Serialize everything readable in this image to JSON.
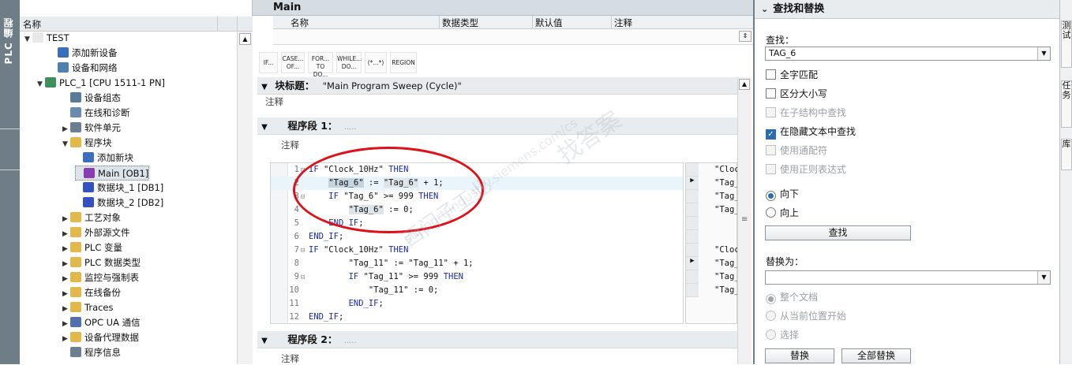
{
  "left_strip": {
    "label": "PLC 编程"
  },
  "tree": {
    "header": "名称",
    "items": [
      {
        "label": "TEST",
        "indent": 0,
        "expand": "▼",
        "icon": "project-icon",
        "color": "#e8e8e8"
      },
      {
        "label": "添加新设备",
        "indent": 2,
        "expand": "",
        "icon": "add-device-icon",
        "color": "#3a6fc0"
      },
      {
        "label": "设备和网络",
        "indent": 2,
        "expand": "",
        "icon": "network-icon",
        "color": "#4d7fb0"
      },
      {
        "label": "PLC_1 [CPU 1511-1 PN]",
        "indent": 1,
        "expand": "▼",
        "icon": "plc-icon",
        "color": "#3d8f5a"
      },
      {
        "label": "设备组态",
        "indent": 3,
        "expand": "",
        "icon": "device-config-icon",
        "color": "#5a7a9a"
      },
      {
        "label": "在线和诊断",
        "indent": 3,
        "expand": "",
        "icon": "diagnostics-icon",
        "color": "#6b8ab0"
      },
      {
        "label": "软件单元",
        "indent": 3,
        "expand": "▶",
        "icon": "software-unit-icon",
        "color": "#6b7f92"
      },
      {
        "label": "程序块",
        "indent": 3,
        "expand": "▼",
        "icon": "folder-icon",
        "color": "#e2b84a"
      },
      {
        "label": "添加新块",
        "indent": 4,
        "expand": "",
        "icon": "add-block-icon",
        "color": "#3a6fc0"
      },
      {
        "label": "Main [OB1]",
        "indent": 4,
        "expand": "",
        "icon": "ob-icon",
        "color": "#8a3db0"
      },
      {
        "label": "数据块_1 [DB1]",
        "indent": 4,
        "expand": "",
        "icon": "db-icon",
        "color": "#3550c0"
      },
      {
        "label": "数据块_2 [DB2]",
        "indent": 4,
        "expand": "",
        "icon": "db-icon",
        "color": "#3550c0"
      },
      {
        "label": "工艺对象",
        "indent": 3,
        "expand": "▶",
        "icon": "technology-icon",
        "color": "#e2b84a"
      },
      {
        "label": "外部源文件",
        "indent": 3,
        "expand": "▶",
        "icon": "source-icon",
        "color": "#e2b84a"
      },
      {
        "label": "PLC 变量",
        "indent": 3,
        "expand": "▶",
        "icon": "tags-icon",
        "color": "#e2b84a"
      },
      {
        "label": "PLC 数据类型",
        "indent": 3,
        "expand": "▶",
        "icon": "datatype-icon",
        "color": "#e2b84a"
      },
      {
        "label": "监控与强制表",
        "indent": 3,
        "expand": "▶",
        "icon": "watch-icon",
        "color": "#e2b84a"
      },
      {
        "label": "在线备份",
        "indent": 3,
        "expand": "▶",
        "icon": "backup-icon",
        "color": "#e2b84a"
      },
      {
        "label": "Traces",
        "indent": 3,
        "expand": "▶",
        "icon": "traces-icon",
        "color": "#e2b84a"
      },
      {
        "label": "OPC UA 通信",
        "indent": 3,
        "expand": "▶",
        "icon": "opcua-icon",
        "color": "#5070b0"
      },
      {
        "label": "设备代理数据",
        "indent": 3,
        "expand": "▶",
        "icon": "proxy-icon",
        "color": "#e2b84a"
      },
      {
        "label": "程序信息",
        "indent": 3,
        "expand": "",
        "icon": "info-icon",
        "color": "#6a7f90"
      }
    ]
  },
  "editor": {
    "tab_title": "Main",
    "interface_columns": [
      "名称",
      "数据类型",
      "默认值",
      "注释"
    ],
    "toolbar": [
      "IF...",
      "CASE... OF...",
      "FOR... TO DO...",
      "WHILE... DO...",
      "(*...*)",
      "REGION"
    ],
    "block_title_label": "块标题：",
    "block_title_value": "\"Main Program Sweep (Cycle)\"",
    "comment": "注释",
    "network1_label": "程序段 1：",
    "network1_dots": ".....",
    "network2_label": "程序段 2：",
    "network2_dots": ".....",
    "code_lines": [
      {
        "n": "1",
        "fold": "⊟",
        "parts": [
          [
            "kw",
            "IF "
          ],
          [
            "",
            "\"Clock_10Hz\" "
          ],
          [
            "kw",
            "THEN"
          ]
        ]
      },
      {
        "n": "2",
        "fold": "",
        "parts": [
          [
            "",
            "    "
          ],
          [
            "hl",
            "\"Tag_6\""
          ],
          [
            "",
            " := "
          ],
          [
            "hl2",
            "\"Tag_6\""
          ],
          [
            "",
            " + 1;"
          ]
        ]
      },
      {
        "n": "3",
        "fold": "⊟",
        "parts": [
          [
            "",
            "    "
          ],
          [
            "kw",
            "IF "
          ],
          [
            "",
            "\"Tag_6\" >= 999 "
          ],
          [
            "kw",
            "THEN"
          ]
        ]
      },
      {
        "n": "4",
        "fold": "",
        "parts": [
          [
            "",
            "        "
          ],
          [
            "hl2",
            "\"Tag_6\""
          ],
          [
            "",
            " := 0;"
          ]
        ]
      },
      {
        "n": "5",
        "fold": "",
        "parts": [
          [
            "",
            "    "
          ],
          [
            "kw",
            "END_IF"
          ],
          [
            "",
            ";"
          ]
        ]
      },
      {
        "n": "6",
        "fold": "",
        "parts": [
          [
            "kw",
            "END_IF"
          ],
          [
            "",
            ";"
          ]
        ]
      },
      {
        "n": "7",
        "fold": "⊟",
        "parts": [
          [
            "kw",
            "IF "
          ],
          [
            "",
            "\"Clock_10Hz\" "
          ],
          [
            "kw",
            "THEN"
          ]
        ]
      },
      {
        "n": "8",
        "fold": "",
        "parts": [
          [
            "",
            "        \"Tag_11\" := \"Tag_11\" + 1;"
          ]
        ]
      },
      {
        "n": "9",
        "fold": "⊟",
        "parts": [
          [
            "",
            "        "
          ],
          [
            "kw",
            "IF "
          ],
          [
            "",
            "\"Tag_11\" >= 999 "
          ],
          [
            "kw",
            "THEN"
          ]
        ]
      },
      {
        "n": "10",
        "fold": "",
        "parts": [
          [
            "",
            "            \"Tag_11\" := 0;"
          ]
        ]
      },
      {
        "n": "11",
        "fold": "",
        "parts": [
          [
            "",
            "        "
          ],
          [
            "kw",
            "END_IF"
          ],
          [
            "",
            ";"
          ]
        ]
      },
      {
        "n": "12",
        "fold": "",
        "parts": [
          [
            "kw",
            "END_IF"
          ],
          [
            "",
            ";"
          ]
        ]
      }
    ],
    "right_col": [
      "\"Cloc",
      "\"Tag_",
      "\"Tag_",
      "\"Tag_",
      "",
      "",
      "\"Cloc",
      "\"Tag_",
      "\"Tag_",
      "\"Tag_"
    ]
  },
  "find": {
    "header": "查找和替换",
    "find_label": "查找：",
    "find_value": "TAG_6",
    "options": [
      {
        "label": "全字匹配",
        "checked": false,
        "disabled": false
      },
      {
        "label": "区分大小写",
        "checked": false,
        "disabled": false
      },
      {
        "label": "在子结构中查找",
        "checked": false,
        "disabled": true
      },
      {
        "label": "在隐藏文本中查找",
        "checked": true,
        "disabled": false
      },
      {
        "label": "使用通配符",
        "checked": false,
        "disabled": true
      },
      {
        "label": "使用正则表达式",
        "checked": false,
        "disabled": true
      }
    ],
    "direction": [
      {
        "label": "向下",
        "selected": true
      },
      {
        "label": "向上",
        "selected": false
      }
    ],
    "find_button": "查找",
    "replace_label": "替换为：",
    "replace_value": "",
    "scope": [
      {
        "label": "整个文档",
        "selected": true
      },
      {
        "label": "从当前位置开始",
        "selected": false
      },
      {
        "label": "选择",
        "selected": false
      }
    ],
    "replace_button": "替换",
    "replace_all_button": "全部替换"
  },
  "right_tabs": [
    "测试",
    "任务",
    "库"
  ],
  "watermark": {
    "lines": [
      "找答案",
      "西门子工业",
      "support.industry.siemens.com/cs"
    ]
  }
}
